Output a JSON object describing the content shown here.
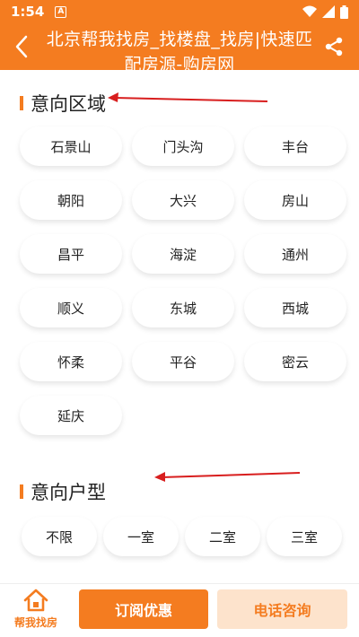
{
  "status": {
    "time": "1:54",
    "notif": "A"
  },
  "header": {
    "title": "北京帮我找房_找楼盘_找房|快速匹配房源-购房网"
  },
  "sections": {
    "area": {
      "title": "意向区域",
      "items": [
        "石景山",
        "门头沟",
        "丰台",
        "朝阳",
        "大兴",
        "房山",
        "昌平",
        "海淀",
        "通州",
        "顺义",
        "东城",
        "西城",
        "怀柔",
        "平谷",
        "密云",
        "延庆"
      ]
    },
    "layout": {
      "title": "意向户型",
      "items": [
        "不限",
        "一室",
        "二室",
        "三室"
      ]
    }
  },
  "bottom": {
    "home_label": "帮我找房",
    "subscribe": "订阅优惠",
    "phone": "电话咨询"
  },
  "colors": {
    "accent": "#f47c20",
    "annotation": "#d81e1e"
  },
  "icons": [
    "back-arrow-icon",
    "share-icon",
    "home-icon",
    "wifi-icon",
    "signal-icon",
    "battery-icon"
  ]
}
